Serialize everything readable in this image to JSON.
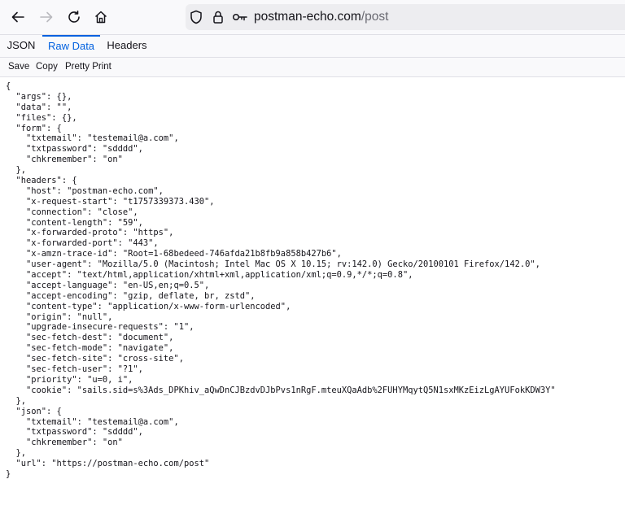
{
  "browser": {
    "url_host": "postman-echo.com",
    "url_path": "/post"
  },
  "viewer": {
    "tabs": [
      {
        "label": "JSON"
      },
      {
        "label": "Raw Data"
      },
      {
        "label": "Headers"
      }
    ],
    "selected_tab": "Raw Data",
    "actions": [
      {
        "label": "Save"
      },
      {
        "label": "Copy"
      },
      {
        "label": "Pretty Print"
      }
    ]
  },
  "raw_lines": [
    "{",
    "  \"args\": {},",
    "  \"data\": \"\",",
    "  \"files\": {},",
    "  \"form\": {",
    "    \"txtemail\": \"testemail@a.com\",",
    "    \"txtpassword\": \"sdddd\",",
    "    \"chkremember\": \"on\"",
    "  },",
    "  \"headers\": {",
    "    \"host\": \"postman-echo.com\",",
    "    \"x-request-start\": \"t1757339373.430\",",
    "    \"connection\": \"close\",",
    "    \"content-length\": \"59\",",
    "    \"x-forwarded-proto\": \"https\",",
    "    \"x-forwarded-port\": \"443\",",
    "    \"x-amzn-trace-id\": \"Root=1-68bedeed-746afda21b8fb9a858b427b6\",",
    "    \"user-agent\": \"Mozilla/5.0 (Macintosh; Intel Mac OS X 10.15; rv:142.0) Gecko/20100101 Firefox/142.0\",",
    "    \"accept\": \"text/html,application/xhtml+xml,application/xml;q=0.9,*/*;q=0.8\",",
    "    \"accept-language\": \"en-US,en;q=0.5\",",
    "    \"accept-encoding\": \"gzip, deflate, br, zstd\",",
    "    \"content-type\": \"application/x-www-form-urlencoded\",",
    "    \"origin\": \"null\",",
    "    \"upgrade-insecure-requests\": \"1\",",
    "    \"sec-fetch-dest\": \"document\",",
    "    \"sec-fetch-mode\": \"navigate\",",
    "    \"sec-fetch-site\": \"cross-site\",",
    "    \"sec-fetch-user\": \"?1\",",
    "    \"priority\": \"u=0, i\",",
    "    \"cookie\": \"sails.sid=s%3Ads_DPKhiv_aQwDnCJBzdvDJbPvs1nRgF.mteuXQaAdb%2FUHYMqytQ5N1sxMKzEizLgAYUFokKDW3Y\"",
    "  },",
    "  \"json\": {",
    "    \"txtemail\": \"testemail@a.com\",",
    "    \"txtpassword\": \"sdddd\",",
    "    \"chkremember\": \"on\"",
    "  },",
    "  \"url\": \"https://postman-echo.com/post\"",
    "}"
  ]
}
